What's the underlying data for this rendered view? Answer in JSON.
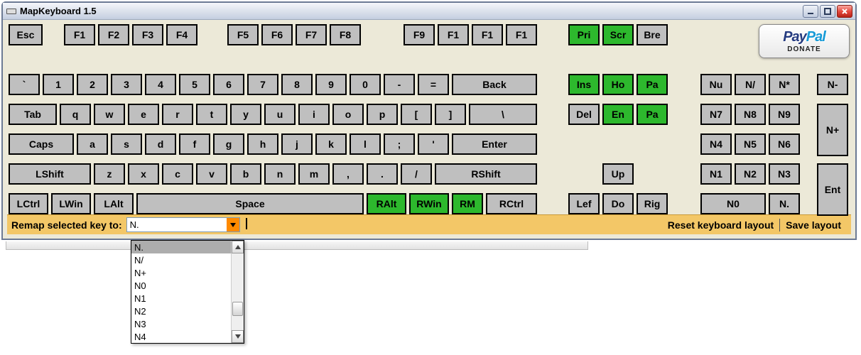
{
  "window": {
    "title": "MapKeyboard 1.5"
  },
  "donate": {
    "brand1": "Pay",
    "brand2": "Pal",
    "sub": "DONATE"
  },
  "keys": {
    "esc": "Esc",
    "f1": "F1",
    "f2": "F2",
    "f3": "F3",
    "f4": "F4",
    "f5": "F5",
    "f6": "F6",
    "f7": "F7",
    "f8": "F8",
    "f9": "F9",
    "f10": "F1",
    "f11": "F1",
    "f12": "F1",
    "pri": "Pri",
    "scr": "Scr",
    "bre": "Bre",
    "tick": "`",
    "k1": "1",
    "k2": "2",
    "k3": "3",
    "k4": "4",
    "k5": "5",
    "k6": "6",
    "k7": "7",
    "k8": "8",
    "k9": "9",
    "k0": "0",
    "minus": "-",
    "equal": "=",
    "back": "Back",
    "ins": "Ins",
    "ho": "Ho",
    "pa": "Pa",
    "tab": "Tab",
    "q": "q",
    "w": "w",
    "e": "e",
    "r": "r",
    "t": "t",
    "y": "y",
    "u": "u",
    "i": "i",
    "o": "o",
    "p": "p",
    "lbr": "[",
    "rbr": "]",
    "bsl": "\\",
    "del": "Del",
    "en": "En",
    "pa2": "Pa",
    "caps": "Caps",
    "a": "a",
    "s": "s",
    "d": "d",
    "f": "f",
    "g": "g",
    "h": "h",
    "j": "j",
    "kk": "k",
    "l": "l",
    "semi": ";",
    "apos": "'",
    "enter": "Enter",
    "lshift": "LShift",
    "z": "z",
    "x": "x",
    "c": "c",
    "v": "v",
    "b": "b",
    "n": "n",
    "m": "m",
    "comma": ",",
    "dot": ".",
    "slash": "/",
    "rshift": "RShift",
    "up": "Up",
    "lctrl": "LCtrl",
    "lwin": "LWin",
    "lalt": "LAlt",
    "space": "Space",
    "ralt": "RAlt",
    "rwin": "RWin",
    "rm": "RM",
    "rctrl": "RCtrl",
    "lef": "Lef",
    "do": "Do",
    "rig": "Rig",
    "nu": "Nu",
    "ndiv": "N/",
    "nmul": "N*",
    "nmin": "N-",
    "n7": "N7",
    "n8": "N8",
    "n9": "N9",
    "nplus": "N+",
    "n4": "N4",
    "n5": "N5",
    "n6": "N6",
    "n1": "N1",
    "n2": "N2",
    "n3": "N3",
    "nent": "Ent",
    "n0": "N0",
    "ndot": "N."
  },
  "bottom": {
    "label": "Remap selected key to:",
    "selected": "N.",
    "reset": "Reset keyboard layout",
    "save": "Save layout"
  },
  "dropdown": {
    "items": [
      "N.",
      "N/",
      "N+",
      "N0",
      "N1",
      "N2",
      "N3",
      "N4"
    ],
    "selectedIndex": 0
  }
}
